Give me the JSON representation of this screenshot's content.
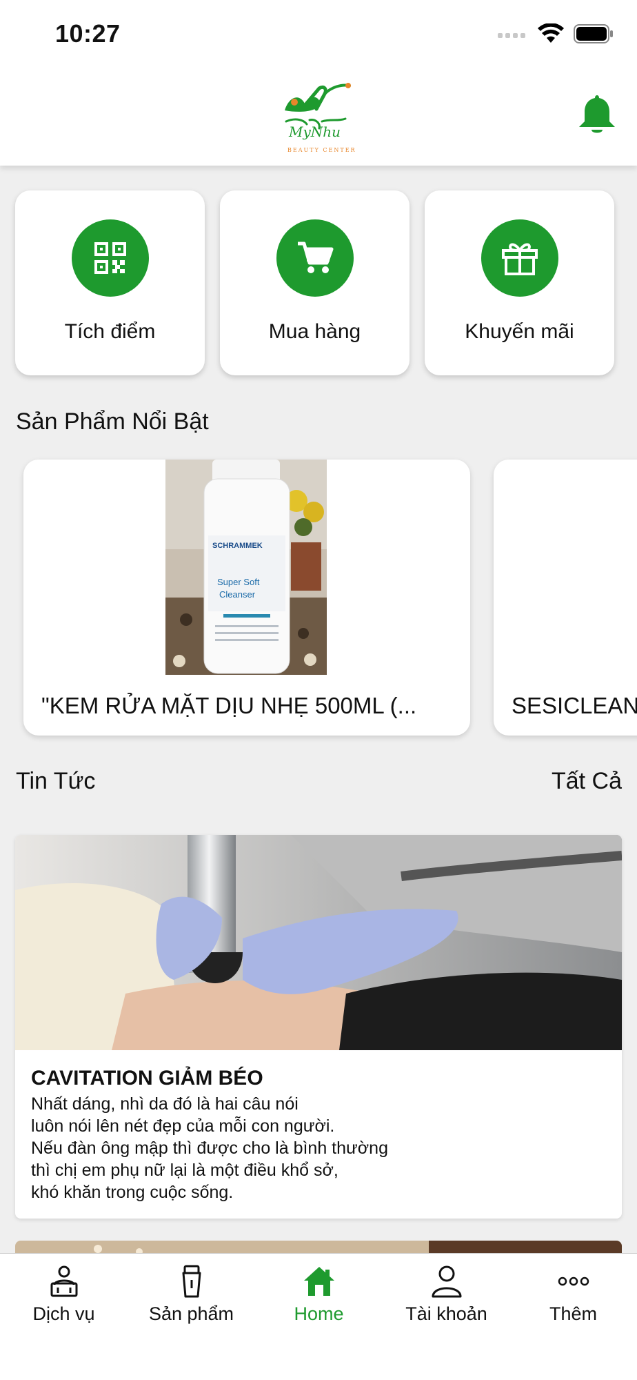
{
  "status_bar": {
    "time": "10:27"
  },
  "header": {
    "logo_brand": "MyNhu",
    "logo_sub": "BEAUTY CENTER",
    "bell_icon": "bell-icon"
  },
  "colors": {
    "accent": "#1e9a2e",
    "background": "#efefef",
    "card": "#ffffff"
  },
  "quick_actions": [
    {
      "label": "Tích điểm",
      "icon": "qr-code-icon"
    },
    {
      "label": "Mua hàng",
      "icon": "cart-icon"
    },
    {
      "label": "Khuyến mãi",
      "icon": "gift-icon"
    }
  ],
  "featured": {
    "title": "Sản Phẩm Nổi Bật",
    "products": [
      {
        "name": "\"KEM RỬA MẶT DỊU  NHẸ 500ML (...",
        "image_text": [
          "SCHRAMMEK",
          "Super Soft",
          "Cleanser"
        ]
      },
      {
        "name": "SESICLEAN"
      }
    ]
  },
  "news": {
    "title": "Tin Tức",
    "see_all": "Tất Cả",
    "items": [
      {
        "title": "CAVITATION GIẢM BÉO",
        "lines": [
          "Nhất dáng, nhì da đó là hai câu nói",
          "luôn nói lên nét đẹp của mỗi con người.",
          "Nếu  đàn ông mập thì được cho là bình thường",
          "thì chị em phụ nữ lại là một điều khổ sở,",
          "khó khăn trong cuộc sống."
        ]
      }
    ]
  },
  "bottom_nav": [
    {
      "label": "Dịch vụ",
      "icon": "service-icon",
      "active": false
    },
    {
      "label": "Sản phẩm",
      "icon": "product-icon",
      "active": false
    },
    {
      "label": "Home",
      "icon": "home-icon",
      "active": true
    },
    {
      "label": "Tài khoản",
      "icon": "account-icon",
      "active": false
    },
    {
      "label": "Thêm",
      "icon": "more-icon",
      "active": false
    }
  ]
}
